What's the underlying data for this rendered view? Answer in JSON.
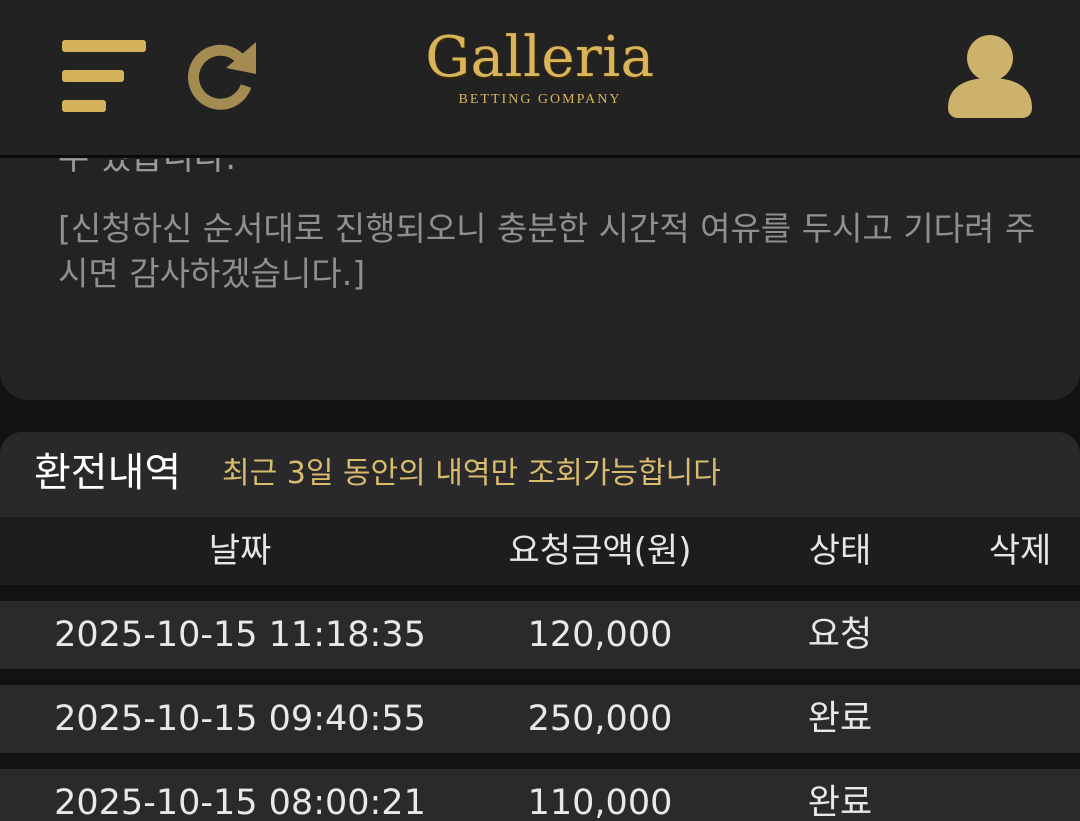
{
  "header": {
    "logo_title": "Galleria",
    "logo_subtitle": "BETTING GOMPANY",
    "accent_color": "#d4b25c",
    "icons": [
      "menu-icon",
      "refresh-icon",
      "user-icon"
    ]
  },
  "notice": {
    "cut_off_line": "수 있습니다.",
    "text": "[신청하신 순서대로 진행되오니 충분한 시간적 여유를 두시고 기다려 주시면 감사하겠습니다.]"
  },
  "history": {
    "title": "환전내역",
    "note": "최근 3일 동안의 내역만 조회가능합니다",
    "columns": [
      "날짜",
      "요청금액(원)",
      "상태",
      "삭제"
    ],
    "rows": [
      {
        "date": "2025-10-15 11:18:35",
        "amount": "120,000",
        "status": "요청",
        "delete": ""
      },
      {
        "date": "2025-10-15 09:40:55",
        "amount": "250,000",
        "status": "완료",
        "delete": ""
      },
      {
        "date": "2025-10-15 08:00:21",
        "amount": "110,000",
        "status": "완료",
        "delete": ""
      }
    ]
  }
}
